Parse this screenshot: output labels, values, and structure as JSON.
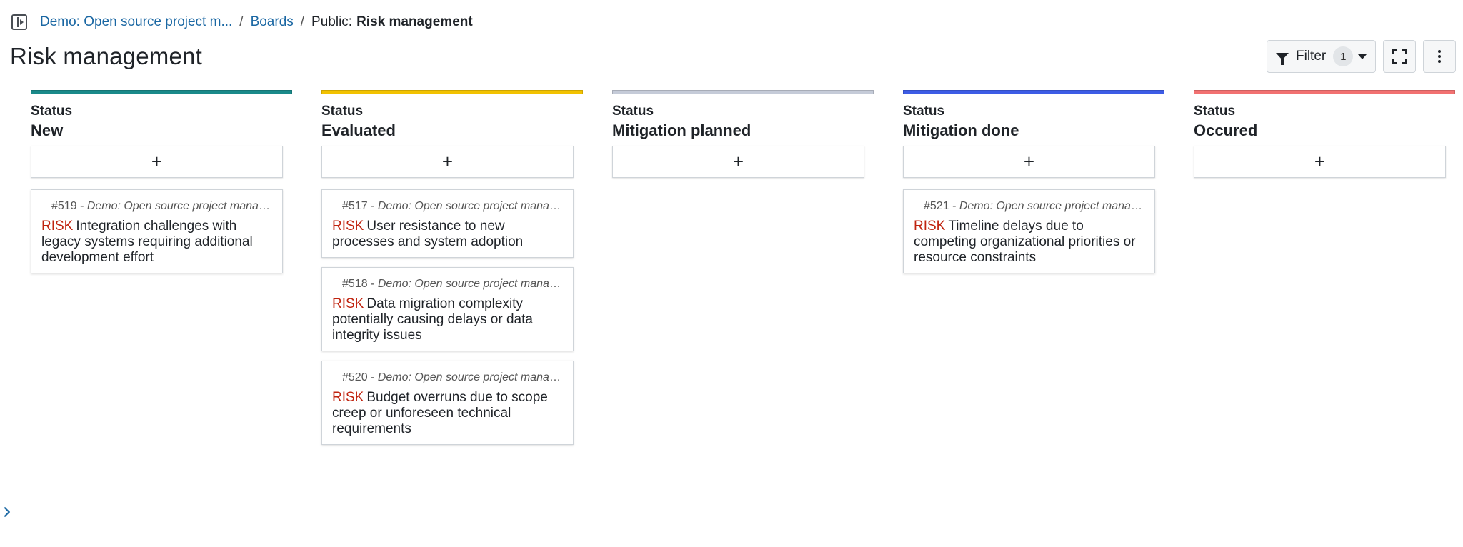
{
  "breadcrumb": {
    "project": "Demo: Open source project m...",
    "section": "Boards",
    "prefix": "Public:",
    "current": "Risk management"
  },
  "page": {
    "title": "Risk management"
  },
  "toolbar": {
    "filter_label": "Filter",
    "filter_count": "1"
  },
  "columns": [
    {
      "label": "Status",
      "name": "New",
      "color": "#1a8a8a",
      "add": "+",
      "cards": [
        {
          "id": "#519",
          "project": "- Demo: Open source project manag...",
          "type": "RISK",
          "subject": "Integration challenges with legacy systems requiring additional development effort"
        }
      ]
    },
    {
      "label": "Status",
      "name": "Evaluated",
      "color": "#f2c200",
      "add": "+",
      "cards": [
        {
          "id": "#517",
          "project": "- Demo: Open source project manag...",
          "type": "RISK",
          "subject": "User resistance to new processes and system adoption"
        },
        {
          "id": "#518",
          "project": "- Demo: Open source project manag...",
          "type": "RISK",
          "subject": "Data migration complexity potentially causing delays or data integrity issues"
        },
        {
          "id": "#520",
          "project": "- Demo: Open source project manag...",
          "type": "RISK",
          "subject": "Budget overruns due to scope creep or unforeseen technical requirements"
        }
      ]
    },
    {
      "label": "Status",
      "name": "Mitigation planned",
      "color": "#c5cbd8",
      "add": "+",
      "cards": []
    },
    {
      "label": "Status",
      "name": "Mitigation done",
      "color": "#3d5ce6",
      "add": "+",
      "cards": [
        {
          "id": "#521",
          "project": "- Demo: Open source project manag...",
          "type": "RISK",
          "subject": "Timeline delays due to competing organizational priorities or resource constraints"
        }
      ]
    },
    {
      "label": "Status",
      "name": "Occured",
      "color": "#f27171",
      "add": "+",
      "cards": []
    }
  ]
}
